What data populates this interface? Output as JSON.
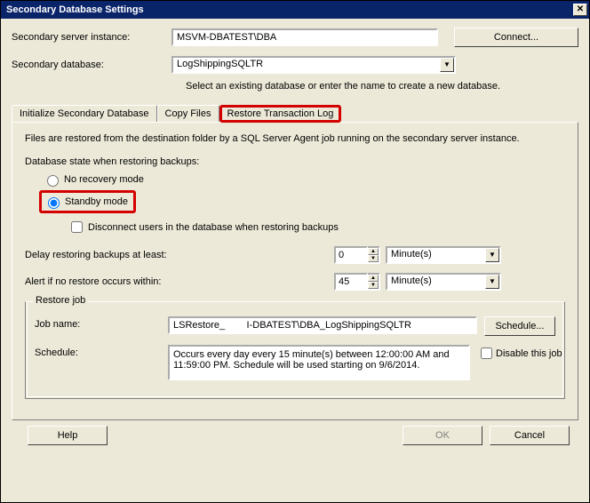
{
  "title": "Secondary Database Settings",
  "header": {
    "server_label": "Secondary server instance:",
    "server_value": "MSVM-DBATEST\\DBA",
    "connect_label": "Connect...",
    "db_label": "Secondary database:",
    "db_value": "LogShippingSQLTR",
    "db_help": "Select an existing database or enter the name to create a new database."
  },
  "tabs": {
    "init": "Initialize Secondary Database",
    "copy": "Copy Files",
    "restore": "Restore Transaction Log"
  },
  "restore": {
    "info": "Files are restored from the destination folder by a SQL Server Agent job running on the secondary server instance.",
    "state_label": "Database state when restoring backups:",
    "no_recovery": "No recovery mode",
    "standby": "Standby mode",
    "disconnect": "Disconnect users in the database when restoring backups",
    "delay_label": "Delay restoring backups at least:",
    "delay_value": "0",
    "delay_unit": "Minute(s)",
    "alert_label": "Alert if no restore occurs within:",
    "alert_value": "45",
    "alert_unit": "Minute(s)"
  },
  "restore_job": {
    "legend": "Restore job",
    "name_label": "Job name:",
    "name_value": "LSRestore_        I-DBATEST\\DBA_LogShippingSQLTR",
    "schedule_btn": "Schedule...",
    "schedule_label": "Schedule:",
    "schedule_text": "Occurs every day every 15 minute(s) between 12:00:00 AM and 11:59:00 PM. Schedule will be used starting on 9/6/2014.",
    "disable": "Disable this job"
  },
  "footer": {
    "help": "Help",
    "ok": "OK",
    "cancel": "Cancel"
  }
}
